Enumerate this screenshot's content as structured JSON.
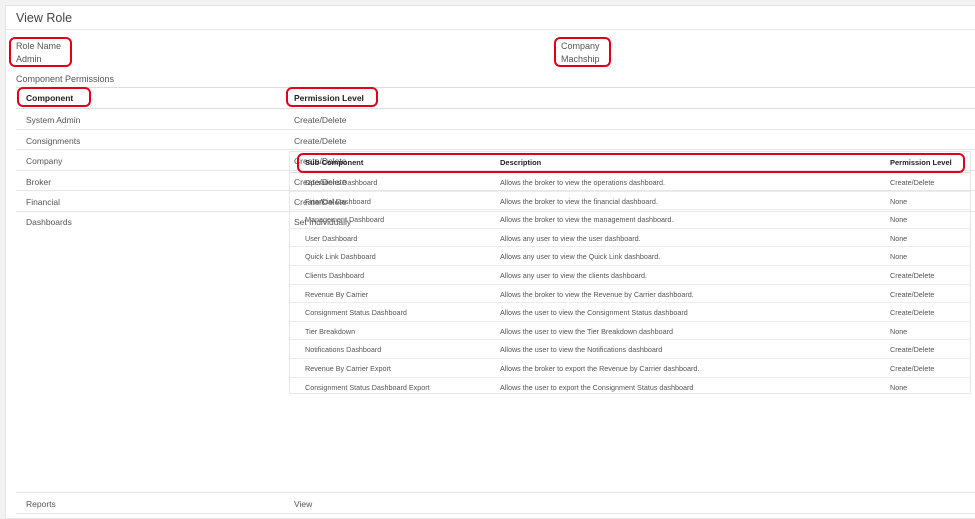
{
  "page": {
    "title": "View Role"
  },
  "role": {
    "name_label": "Role Name",
    "name_value": "Admin",
    "company_label": "Company",
    "company_value": "Machship"
  },
  "permissions": {
    "section_label": "Component Permissions",
    "headers": {
      "component": "Component",
      "level": "Permission Level"
    },
    "rows": [
      {
        "component": "System Admin",
        "level": "Create/Delete"
      },
      {
        "component": "Consignments",
        "level": "Create/Delete"
      },
      {
        "component": "Company",
        "level": "Create/Delete"
      },
      {
        "component": "Broker",
        "level": "Create/Delete"
      },
      {
        "component": "Financial",
        "level": "Create/Delete"
      },
      {
        "component": "Dashboards",
        "level": "Set Individually"
      },
      {
        "component": "Reports",
        "level": "View"
      }
    ]
  },
  "dashboards": {
    "headers": {
      "sub_component": "Sub-Component",
      "description": "Description",
      "level": "Permission Level"
    },
    "rows": [
      {
        "name": "Operations Dashboard",
        "description": "Allows the broker to view the operations dashboard.",
        "level": "Create/Delete"
      },
      {
        "name": "Financial Dashboard",
        "description": "Allows the broker to view the financial dashboard.",
        "level": "None"
      },
      {
        "name": "Management Dashboard",
        "description": "Allows the broker to view the management dashboard.",
        "level": "None"
      },
      {
        "name": "User Dashboard",
        "description": "Allows any user to view the user dashboard.",
        "level": "None"
      },
      {
        "name": "Quick Link Dashboard",
        "description": "Allows any user to view the Quick Link dashboard.",
        "level": "None"
      },
      {
        "name": "Clients Dashboard",
        "description": "Allows any user to view the clients dashboard.",
        "level": "Create/Delete"
      },
      {
        "name": "Revenue By Carrier",
        "description": "Allows the broker to view the Revenue by Carrier dashboard.",
        "level": "Create/Delete"
      },
      {
        "name": "Consignment Status Dashboard",
        "description": "Allows the user to view the Consignment Status dashboard",
        "level": "Create/Delete"
      },
      {
        "name": "Tier Breakdown",
        "description": "Allows the user to view the Tier Breakdown dashboard",
        "level": "None"
      },
      {
        "name": "Notifications Dashboard",
        "description": "Allows the user to view the Notifications dashboard",
        "level": "Create/Delete"
      },
      {
        "name": "Revenue By Carrier Export",
        "description": "Allows the broker to export the Revenue by Carrier dashboard.",
        "level": "Create/Delete"
      },
      {
        "name": "Consignment Status Dashboard Export",
        "description": "Allows the user to export the Consignment Status dashboard",
        "level": "None"
      }
    ]
  },
  "colors": {
    "highlight": "#e1001a",
    "border": "#e6e6e6"
  }
}
